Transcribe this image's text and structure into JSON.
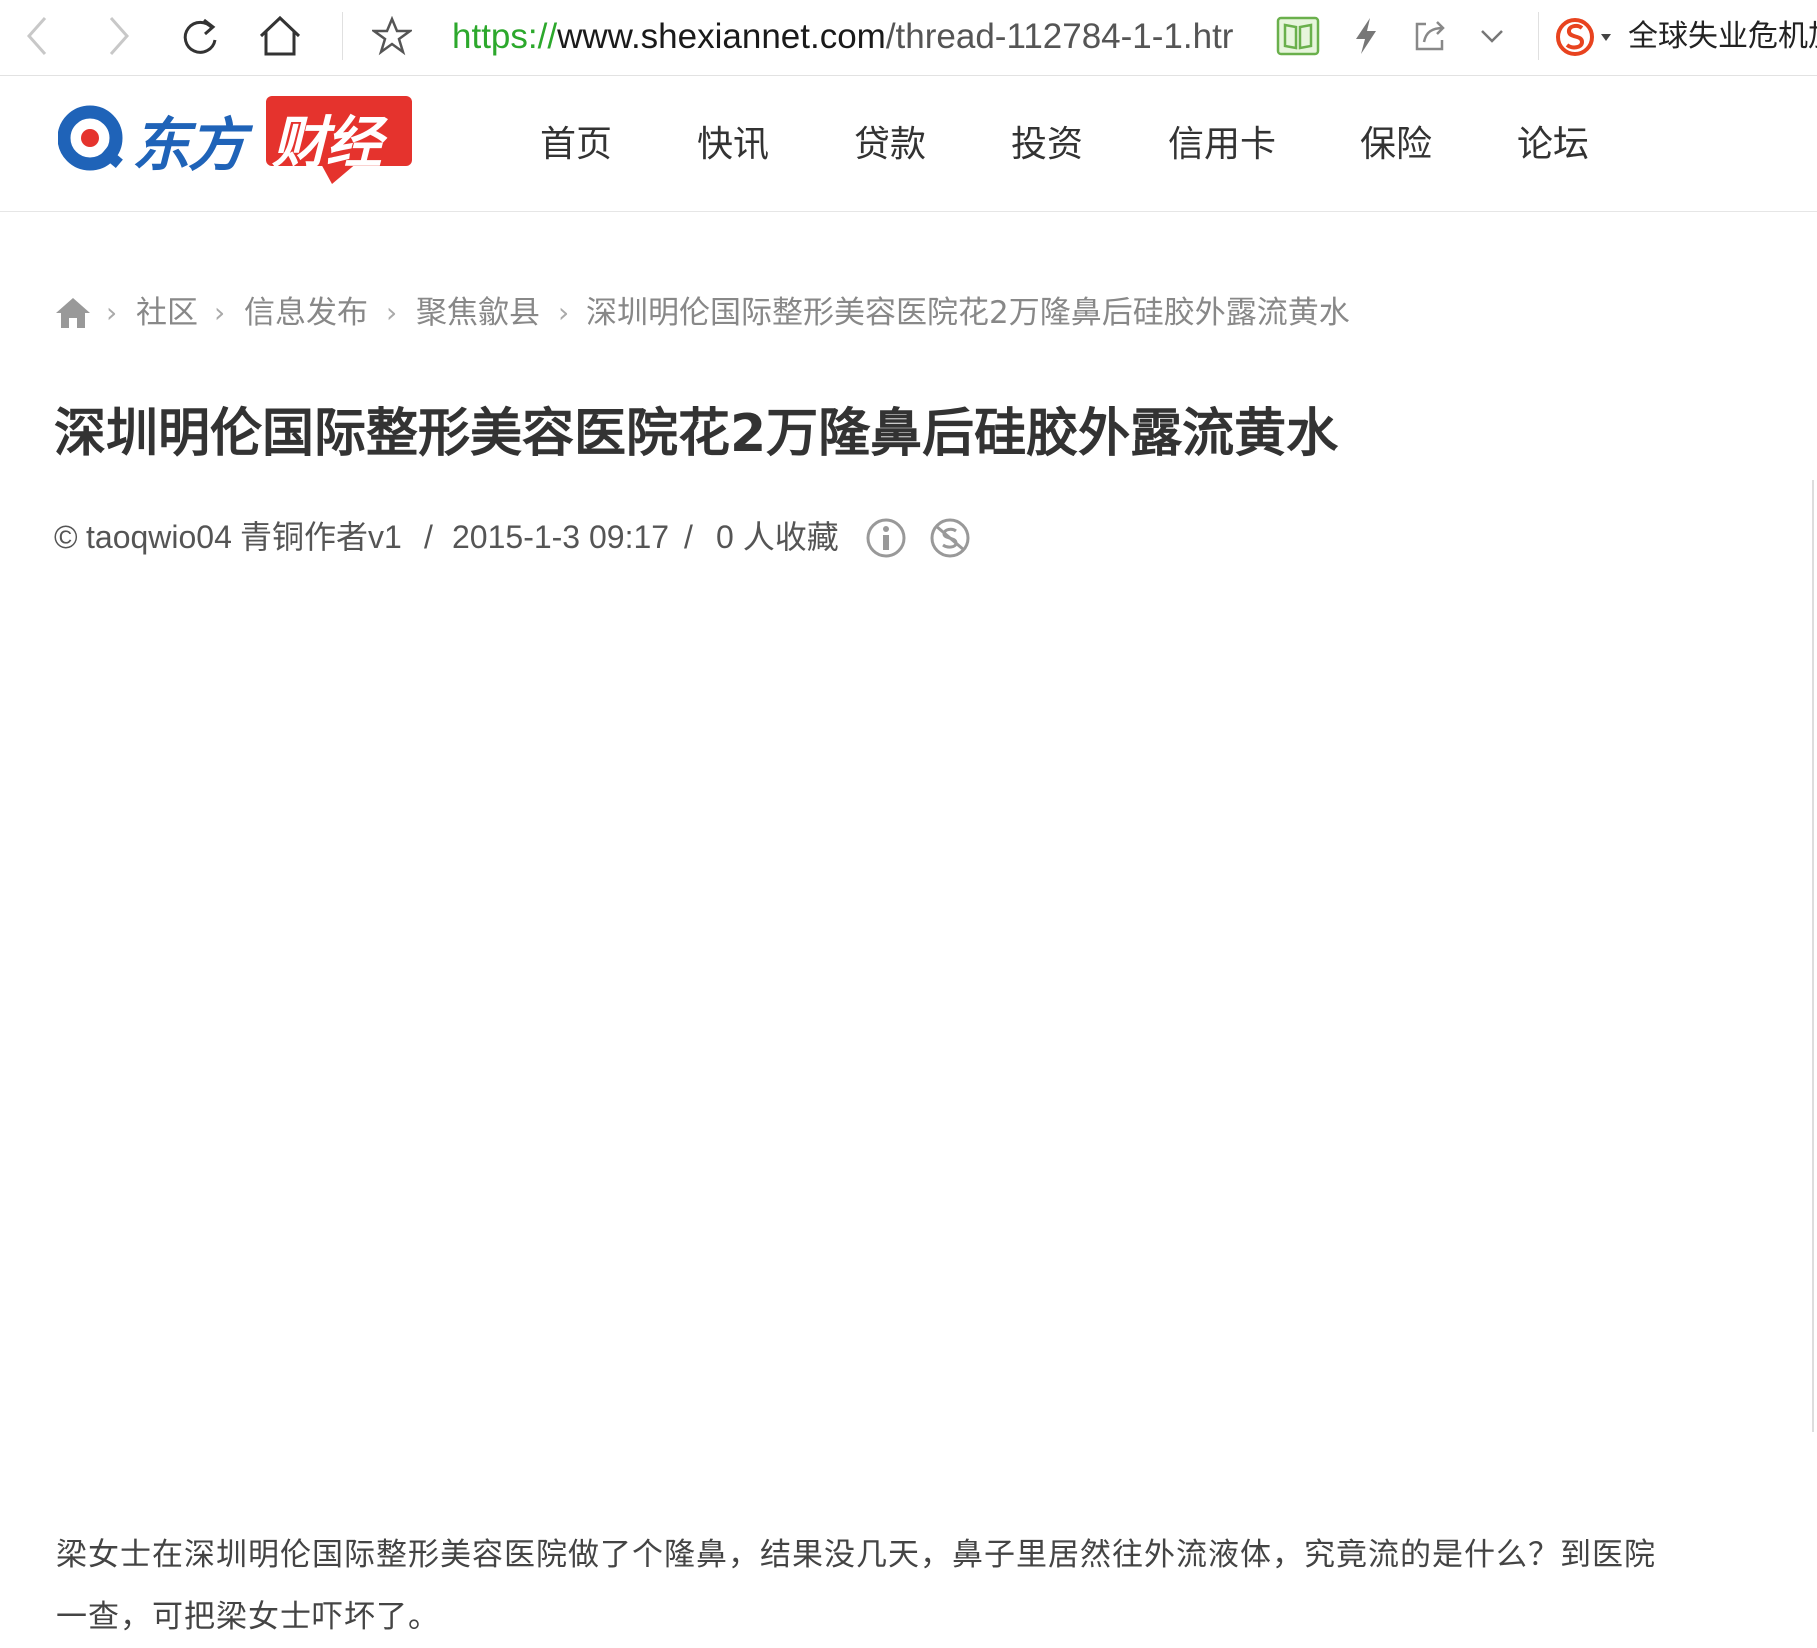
{
  "browser": {
    "url_scheme": "https://",
    "url_host": "www.shexiannet.com",
    "url_path": "/thread-112784-1-1.htr",
    "news_ticker": "全球失业危机加"
  },
  "site": {
    "logo_blue": "东方",
    "logo_red": "财经",
    "nav": [
      "首页",
      "快讯",
      "贷款",
      "投资",
      "信用卡",
      "保险",
      "论坛"
    ]
  },
  "breadcrumb": {
    "items": [
      "社区",
      "信息发布",
      "聚焦歙县",
      "深圳明伦国际整形美容医院花2万隆鼻后硅胶外露流黄水"
    ],
    "separator": "›"
  },
  "article": {
    "title": "深圳明伦国际整形美容医院花2万隆鼻后硅胶外露流黄水",
    "author_prefix": "©",
    "author": "taoqwio04",
    "author_rank": "青铜作者v1",
    "meta_sep": "/",
    "date": "2015-1-3 09:17",
    "favorites": "0 人收藏",
    "body": "梁女士在深圳明伦国际整形美容医院做了个隆鼻，结果没几天，鼻子里居然往外流液体，究竟流的是什么？到医院一查，可把梁女士吓坏了。"
  },
  "colors": {
    "url_scheme": "#2ca82c",
    "logo_blue": "#1f63b8",
    "logo_red": "#e5332d",
    "reader_icon": "#6ab04c"
  }
}
